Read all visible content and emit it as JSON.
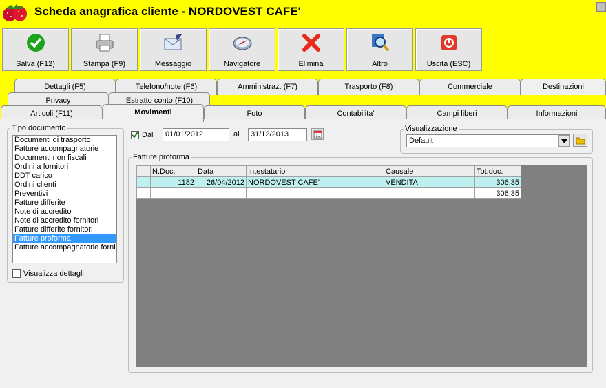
{
  "window": {
    "title": "Scheda anagrafica cliente - NORDOVEST CAFE'",
    "icon": "strawberry-icon"
  },
  "toolbar": {
    "buttons": [
      {
        "label": "Salva (F12)",
        "icon": "check-icon"
      },
      {
        "label": "Stampa (F9)",
        "icon": "printer-icon"
      },
      {
        "label": "Messaggio",
        "icon": "envelope-pen-icon"
      },
      {
        "label": "Navigatore",
        "icon": "compass-icon"
      },
      {
        "label": "Elimina",
        "icon": "delete-x-icon"
      },
      {
        "label": "Altro",
        "icon": "magnifier-icon"
      },
      {
        "label": "Uscita (ESC)",
        "icon": "power-icon"
      }
    ]
  },
  "tabs": {
    "row1": [
      "Dettagli (F5)",
      "Telefono/note (F6)",
      "Amministraz. (F7)",
      "Trasporto (F8)",
      "Commerciale",
      "Destinazioni"
    ],
    "row2": [
      "Privacy",
      "Estratto conto (F10)"
    ],
    "row3": [
      "Articoli (F11)",
      "Movimenti",
      "Foto",
      "Contabilita'",
      "Campi liberi",
      "Informazioni"
    ],
    "active": "Movimenti"
  },
  "tipo_documento": {
    "legend": "Tipo documento",
    "items": [
      "Documenti di trasporto",
      "Fatture accompagnatorie",
      "Documenti non fiscali",
      "Ordini a fornitori",
      "DDT carico",
      "Ordini clienti",
      "Preventivi",
      "Fatture differite",
      "Note di accredito",
      "Note di accredito fornitori",
      "Fatture differite fornitori",
      "Fatture proforma",
      "Fatture accompagnatorie forni"
    ],
    "selected": "Fatture proforma",
    "visualizza_dettagli_label": "Visualizza dettagli",
    "visualizza_dettagli_checked": false
  },
  "date_filter": {
    "dal_label": "Dal",
    "dal_checked": true,
    "from": "01/01/2012",
    "al_label": "al",
    "to": "31/12/2013"
  },
  "visualizzazione": {
    "legend": "Visualizzazione",
    "selected": "Default"
  },
  "fatture": {
    "legend": "Fatture proforma",
    "columns": [
      "N.Doc.",
      "Data",
      "Intestatario",
      "Causale",
      "Tot.doc."
    ],
    "rows": [
      {
        "ndoc": "1182",
        "data": "26/04/2012",
        "intestatario": "NORDOVEST CAFE'",
        "causale": "VENDITA",
        "tot": "306,35"
      }
    ],
    "total": "306,35"
  },
  "colors": {
    "accent_yellow": "#ffff00",
    "selection_blue": "#3399ff",
    "row_highlight": "#bff0f0",
    "grid_background": "#808080"
  }
}
